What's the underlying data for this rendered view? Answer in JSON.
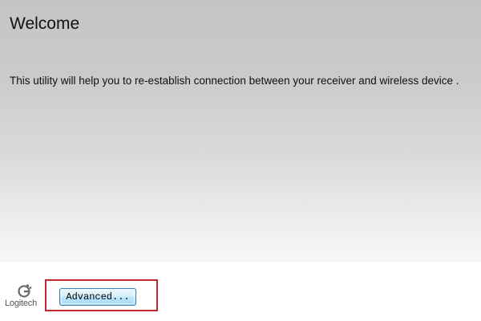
{
  "page": {
    "title": "Welcome",
    "description": "This utility will help you to re-establish connection between your receiver and wireless device ."
  },
  "footer": {
    "logo_text": "Logitech",
    "advanced_button_label": "Advanced...",
    "highlight_color": "#c1272d"
  },
  "colors": {
    "button_border": "#3c7fb1",
    "button_fill": "#bee6fd"
  }
}
